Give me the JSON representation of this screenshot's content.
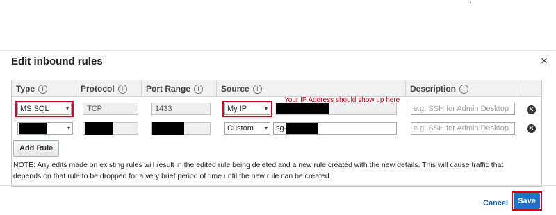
{
  "top_mark": ".",
  "dialog": {
    "title": "Edit inbound rules",
    "close_icon": "×"
  },
  "columns": {
    "type": "Type",
    "protocol": "Protocol",
    "port_range": "Port Range",
    "source": "Source",
    "description": "Description",
    "info_glyph": "i"
  },
  "rows": [
    {
      "type": "MS SQL",
      "protocol": "TCP",
      "port_range": "1433",
      "source": "My IP",
      "source_value": "",
      "description_placeholder": "e.g. SSH for Admin Desktop"
    },
    {
      "type": "",
      "protocol": "",
      "port_range": "",
      "source": "Custom",
      "source_value": "sg-",
      "description_placeholder": "e.g. SSH for Admin Desktop"
    }
  ],
  "annotation": "Your IP Address should show up here",
  "add_rule_label": "Add Rule",
  "note": "NOTE: Any edits made on existing rules will result in the edited rule being deleted and a new rule created with the new details. This will cause traffic that depends on that rule to be dropped for a very brief period of time until the new rule can be created.",
  "footer": {
    "cancel_label": "Cancel",
    "save_label": "Save"
  },
  "icons": {
    "chevron": "▾",
    "remove": "✕"
  },
  "colors": {
    "highlight": "#e0001b",
    "primary_button": "#1e73c8",
    "link": "#1166bb"
  }
}
